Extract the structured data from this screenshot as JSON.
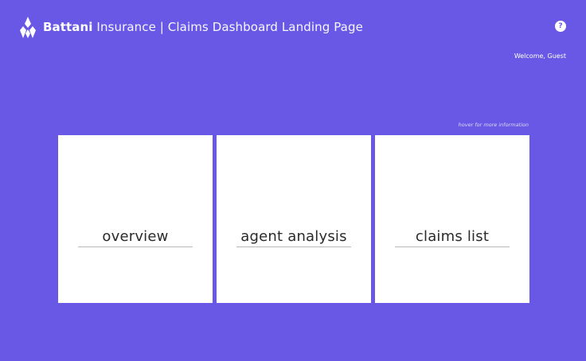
{
  "header": {
    "brand": "Battani",
    "subtitle": "Insurance | Claims Dashboard Landing Page",
    "logo_icon": "diamond-flame-logo-icon",
    "help_label": "?"
  },
  "user": {
    "welcome": "Welcome, Guest"
  },
  "hint": "hover for more information",
  "cards": [
    {
      "label": "overview"
    },
    {
      "label": "agent analysis"
    },
    {
      "label": "claims list"
    }
  ],
  "colors": {
    "background": "#6958e5",
    "card": "#ffffff",
    "card_text": "#2a2a2a"
  }
}
